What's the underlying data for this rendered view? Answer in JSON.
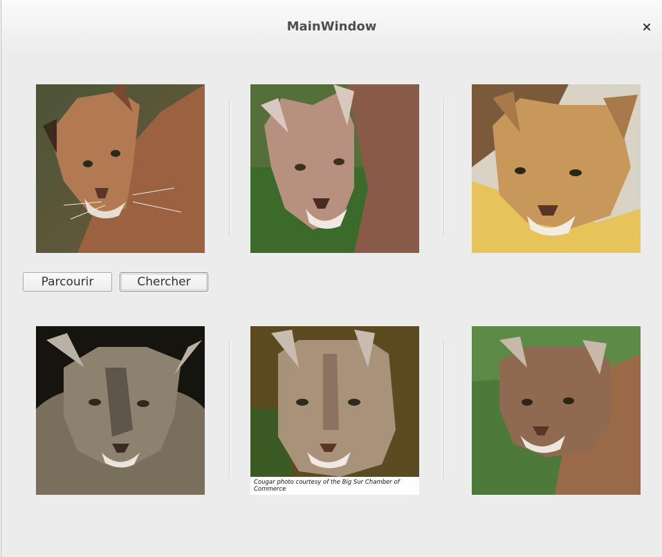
{
  "window": {
    "title": "MainWindow",
    "close_icon": "close-icon"
  },
  "buttons": {
    "browse_label": "Parcourir",
    "search_label": "Chercher"
  },
  "results": [
    {
      "name": "cougar-photo-1",
      "background": "#5c5a3a",
      "fur": "#a8724a"
    },
    {
      "name": "cougar-photo-2",
      "background": "#3e6a2c",
      "fur": "#b08468"
    },
    {
      "name": "cougar-photo-3",
      "background": "#d8d2c4",
      "fur": "#c89a5a"
    },
    {
      "name": "cougar-photo-4",
      "background": "#1c1a16",
      "fur": "#8a7a64"
    },
    {
      "name": "cougar-photo-5",
      "background": "#6a5a2c",
      "fur": "#a89276"
    },
    {
      "name": "cougar-photo-6",
      "background": "#4f7a3c",
      "fur": "#9a7050"
    }
  ],
  "photo_caption": "Cougar photo courtesy of the Big Sur Chamber of Commerce",
  "colors": {
    "window_bg": "#ececec",
    "title_text": "#4b4f50",
    "button_text": "#2e3436"
  }
}
